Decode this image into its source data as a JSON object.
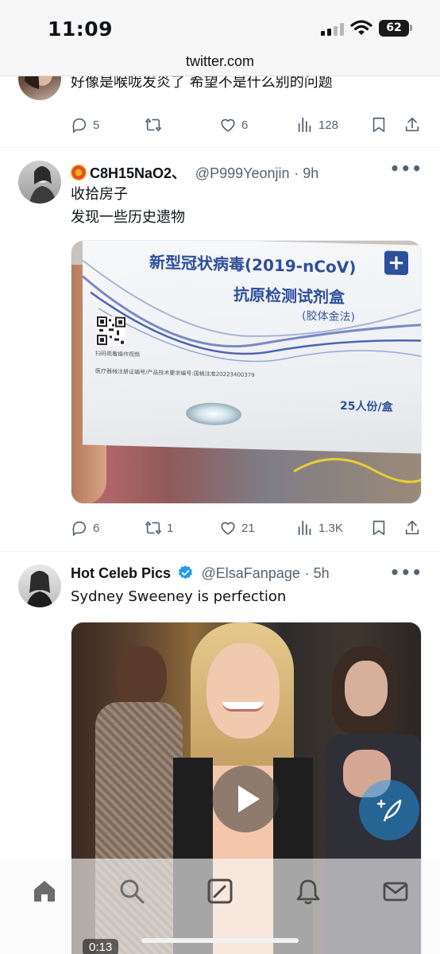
{
  "status_bar": {
    "time": "11:09",
    "battery": "62"
  },
  "browser": {
    "url": "twitter.com"
  },
  "tweets": [
    {
      "text_lines": [
        "好像是喉咙发炎了 希望不是什么别的问题"
      ],
      "replies": "5",
      "reposts": "",
      "likes": "6",
      "views": "128"
    },
    {
      "name": "C8H15NaO2、",
      "handle": "@P999Yeonjin",
      "time": "· 9h",
      "text_lines": [
        "收拾房子",
        "发现一些历史遗物"
      ],
      "media": {
        "box_title": "新型冠状病毒(2019-nCoV)",
        "box_subtitle": "抗原检测试剂盒",
        "box_method": "(胶体金法)",
        "box_scan": "扫码观看操作视频",
        "box_reg": "医疗器械注册证编号/产品技术要求编号:国械注准20223400379",
        "box_count": "25人份/盒"
      },
      "replies": "6",
      "reposts": "1",
      "likes": "21",
      "views": "1.3K"
    },
    {
      "name": "Hot Celeb Pics",
      "handle": "@ElsaFanpage",
      "time": "· 5h",
      "verified": true,
      "text_lines": [
        "Sydney Sweeney is perfection"
      ],
      "video_duration": "0:13"
    }
  ],
  "colors": {
    "accent": "#1d9bf0",
    "muted": "#536471",
    "verified": "#1d9bf0"
  },
  "icons": [
    "reply-icon",
    "repost-icon",
    "like-icon",
    "views-icon",
    "bookmark-icon",
    "share-icon",
    "more-icon",
    "home-icon",
    "search-icon",
    "compose-icon",
    "notifications-icon",
    "messages-icon",
    "play-icon",
    "compose-fab-icon"
  ]
}
